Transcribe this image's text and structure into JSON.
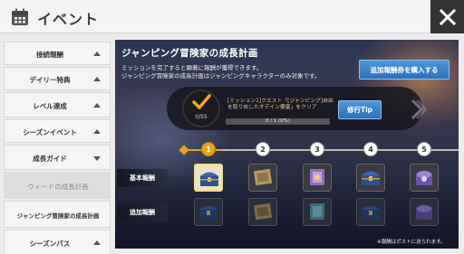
{
  "header": {
    "title": "イベント",
    "calendar_icon": "calendar-icon",
    "close_icon": "close-icon"
  },
  "sidebar": {
    "items": [
      {
        "label": "接続報酬",
        "arrow": "up"
      },
      {
        "label": "デイリー特典",
        "arrow": "up"
      },
      {
        "label": "レベル達成",
        "arrow": "up"
      },
      {
        "label": "シーズンイベント",
        "arrow": "up"
      },
      {
        "label": "成長ガイド",
        "arrow": "down"
      },
      {
        "label": "ウィードの成長計画",
        "selected": true
      },
      {
        "label": "ジャンピング冒険家の成長計画"
      },
      {
        "label": "シーズンパス",
        "arrow": "up"
      }
    ]
  },
  "main": {
    "title": "ジャンピング冒険家の成長計画",
    "desc_line1": "ミッションを完了すると顕著に報酬が獲得できます。",
    "desc_line2": "ジャンピング冒険家の成長計画はジャンピングキャラクターのみ対象です。",
    "buy_button": "追加報酬券を購入する",
    "mission": {
      "count": "0/55",
      "text_line1": "[ミッション1]クエスト「[ジャンピング]自由",
      "text_line2": "を取り戻したオデイン要塞」をクリア",
      "progress_label": "0 / 1 (0%)",
      "progress": 0
    },
    "tip_button": "修行Tip",
    "steps": [
      "1",
      "2",
      "3",
      "4",
      "5"
    ],
    "row_basic": "基本報酬",
    "row_extra": "追加報酬",
    "footnote": "※報酬はポストに送られます。"
  },
  "colors": {
    "accent_orange": "#e8a21e",
    "button_blue": "#2f6fb6",
    "dark_header": "#333333"
  }
}
